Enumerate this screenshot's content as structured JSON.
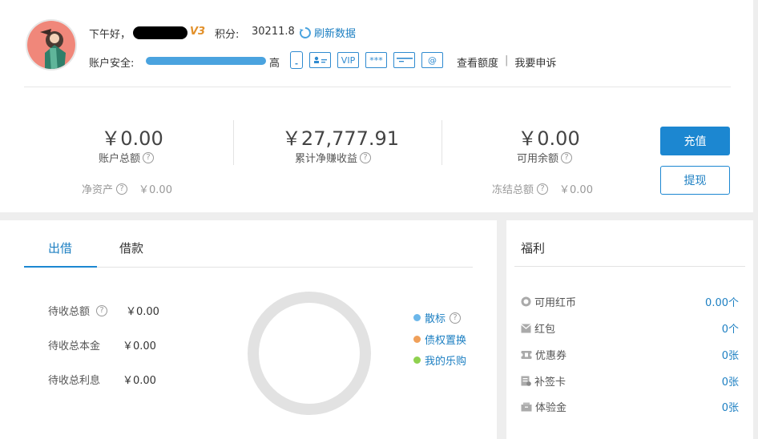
{
  "header": {
    "greeting": "下午好，",
    "vip_badge": "V3",
    "score_label": "积分:",
    "score_value": "30211.8",
    "refresh_label": "刷新数据",
    "safety_label": "账户安全:",
    "safety_level": "高",
    "safety_progress": 1.0,
    "security_icons": [
      {
        "name": "phone-icon",
        "text": ""
      },
      {
        "name": "id-card-icon",
        "text": ""
      },
      {
        "name": "vip-icon",
        "text": "VIP"
      },
      {
        "name": "password-icon",
        "text": "***"
      },
      {
        "name": "bank-card-icon",
        "text": ""
      },
      {
        "name": "email-icon",
        "text": "@"
      }
    ],
    "link_quota": "查看额度",
    "link_separator": "|",
    "link_complaint": "我要申诉"
  },
  "summary": {
    "total_amount": "￥0.00",
    "total_label": "账户总额",
    "net_income": "￥27,777.91",
    "net_income_label": "累计净赚收益",
    "available": "￥0.00",
    "available_label": "可用余额",
    "net_assets_label": "净资产",
    "net_assets_value": "￥0.00",
    "frozen_label": "冻结总额",
    "frozen_value": "￥0.00",
    "help_glyph": "?"
  },
  "actions": {
    "recharge": "充值",
    "withdraw": "提现"
  },
  "lending": {
    "tabs": [
      "出借",
      "借款"
    ],
    "rows": [
      {
        "label": "待收总额",
        "value": "￥0.00"
      },
      {
        "label": "待收总本金",
        "value": "￥0.00"
      },
      {
        "label": "待收总利息",
        "value": "￥0.00"
      }
    ],
    "legend": [
      {
        "label": "散标",
        "color": "#6cb7ea"
      },
      {
        "label": "债权置换",
        "color": "#f0a05a"
      },
      {
        "label": "我的乐购",
        "color": "#8fd14f"
      }
    ],
    "ring_color": "#e2e2e2"
  },
  "welfare": {
    "title": "福利",
    "items": [
      {
        "label": "可用红币",
        "value": "0.00个",
        "icon": "coin-icon"
      },
      {
        "label": "红包",
        "value": "0个",
        "icon": "red-envelope-icon"
      },
      {
        "label": "优惠券",
        "value": "0张",
        "icon": "coupon-icon"
      },
      {
        "label": "补签卡",
        "value": "0张",
        "icon": "resign-card-icon"
      },
      {
        "label": "体验金",
        "value": "0张",
        "icon": "trial-fund-icon"
      }
    ]
  }
}
